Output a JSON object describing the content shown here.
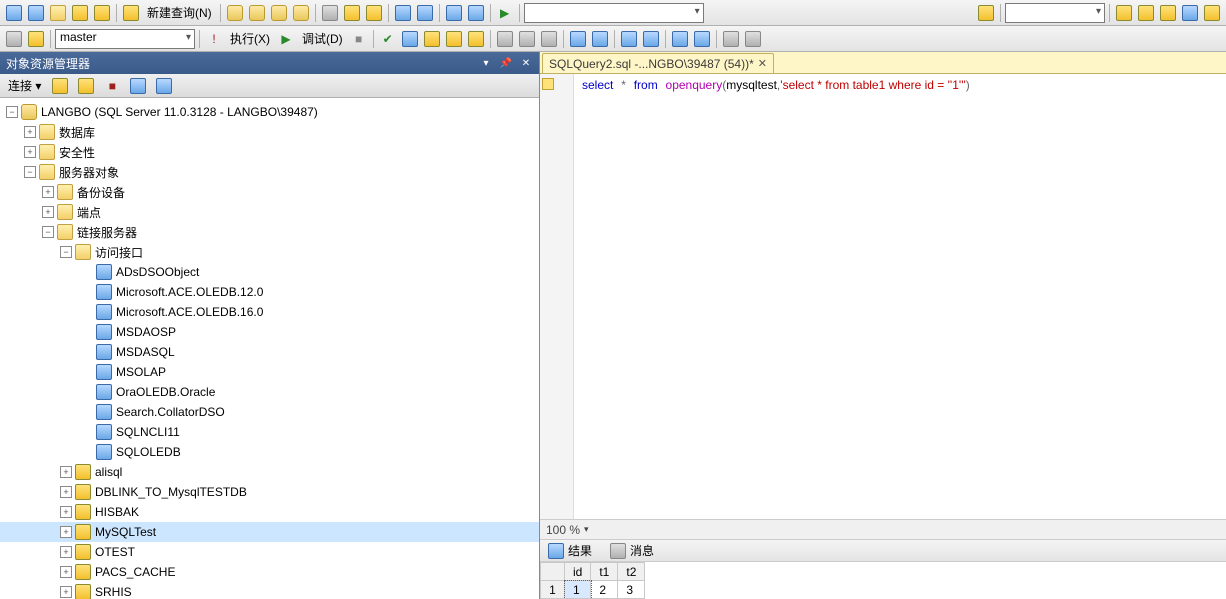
{
  "toolbar1": {
    "new_query_label": "新建查询(N)"
  },
  "toolbar2": {
    "database": "master",
    "execute_label": "执行(X)",
    "debug_label": "调试(D)"
  },
  "explorer": {
    "title": "对象资源管理器",
    "connect_label": "连接 ▾",
    "server_label": "LANGBO (SQL Server 11.0.3128 - LANGBO\\39487)",
    "nodes": {
      "databases": "数据库",
      "security": "安全性",
      "server_objects": "服务器对象",
      "backup_devices": "备份设备",
      "endpoints": "端点",
      "linked_servers": "链接服务器",
      "access_interfaces": "访问接口",
      "ads": "ADsDSOObject",
      "ace12": "Microsoft.ACE.OLEDB.12.0",
      "ace16": "Microsoft.ACE.OLEDB.16.0",
      "msdaosp": "MSDAOSP",
      "msdasql": "MSDASQL",
      "msolap": "MSOLAP",
      "oraoledb": "OraOLEDB.Oracle",
      "searchcollator": "Search.CollatorDSO",
      "sqlncli11": "SQLNCLI11",
      "sqloledb": "SQLOLEDB",
      "alisql": "alisql",
      "dblink": "DBLINK_TO_MysqlTESTDB",
      "hisbak": "HISBAK",
      "mysqltest": "MySQLTest",
      "otest": "OTEST",
      "pacs": "PACS_CACHE",
      "srhis": "SRHIS"
    }
  },
  "editor": {
    "tab_label": "SQLQuery2.sql -...NGBO\\39487 (54))*",
    "sql": {
      "k_select": "select",
      "k_star": "*",
      "k_from": "from",
      "k_openquery": "openquery",
      "p_open": "(",
      "p_target": "mysqltest",
      "p_comma": ",",
      "q_open": "'",
      "q_body": "select * from table1 where id = ''1''",
      "q_close": "'",
      "p_close": ")"
    }
  },
  "zoom": {
    "value": "100 %"
  },
  "result_tabs": {
    "results": "结果",
    "messages": "消息"
  },
  "grid": {
    "headers": [
      "",
      "id",
      "t1",
      "t2"
    ],
    "rows": [
      {
        "num": "1",
        "id": "1",
        "t1": "2",
        "t2": "3"
      }
    ]
  }
}
